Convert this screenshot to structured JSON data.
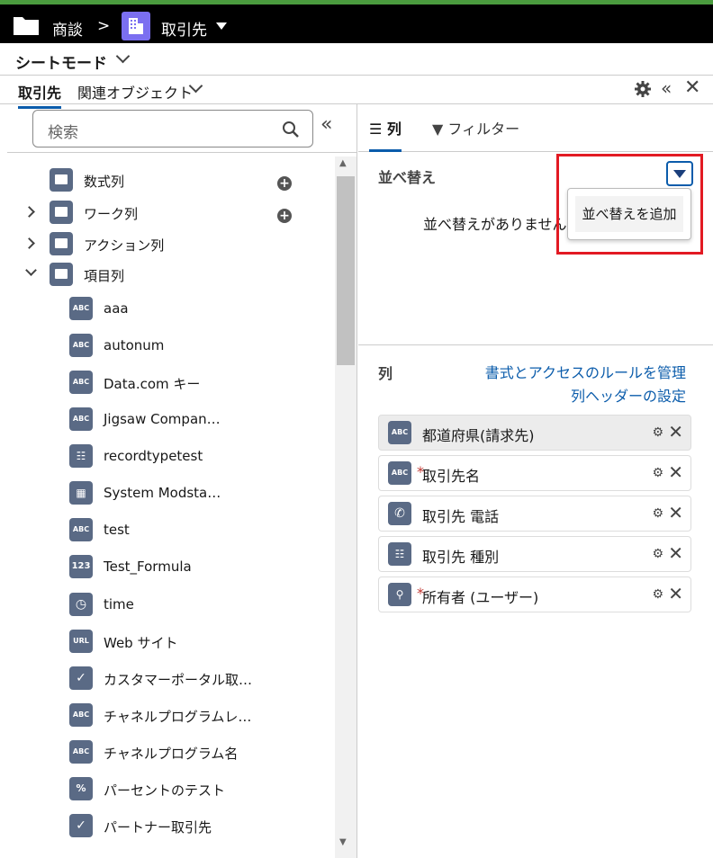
{
  "header": {
    "root_label": "商談",
    "separator": ">",
    "object_label": "取引先"
  },
  "mode": {
    "title": "シートモード"
  },
  "tabs": {
    "primary": "取引先",
    "secondary": "関連オブジェクト"
  },
  "left": {
    "search_placeholder": "検索",
    "nodes": [
      {
        "label": "数式列",
        "type": "folder"
      },
      {
        "label": "ワーク列",
        "type": "folder"
      },
      {
        "label": "アクション列",
        "type": "folder"
      },
      {
        "label": "項目列",
        "type": "folder-open"
      }
    ],
    "fields": [
      {
        "label": "aaa",
        "icon": "ABC"
      },
      {
        "label": "autonum",
        "icon": "ABC"
      },
      {
        "label": "Data.com キー",
        "icon": "ABC"
      },
      {
        "label": "Jigsaw Compan…",
        "icon": "ABC"
      },
      {
        "label": "recordtypetest",
        "icon": "list"
      },
      {
        "label": "System Modsta…",
        "icon": "calendar"
      },
      {
        "label": "test",
        "icon": "ABC"
      },
      {
        "label": "Test_Formula",
        "icon": "123"
      },
      {
        "label": "time",
        "icon": "clock"
      },
      {
        "label": "Web サイト",
        "icon": "URL"
      },
      {
        "label": "カスタマーポータル取…",
        "icon": "check"
      },
      {
        "label": "チャネルプログラムレ…",
        "icon": "ABC"
      },
      {
        "label": "チャネルプログラム名",
        "icon": "ABC"
      },
      {
        "label": "パーセントのテスト",
        "icon": "%"
      },
      {
        "label": "パートナー取引先",
        "icon": "check"
      }
    ]
  },
  "right": {
    "tab_columns": "列",
    "tab_filter": "フィルター",
    "sort_heading": "並べ替え",
    "sort_empty": "並べ替えがありません",
    "menu_item": "並べ替えを追加",
    "columns_heading": "列",
    "link_rules": "書式とアクセスのルールを管理",
    "link_header": "列ヘッダーの設定",
    "columns": [
      {
        "label": "都道府県(請求先)",
        "icon": "ABC",
        "required": false
      },
      {
        "label": "取引先名",
        "icon": "ABC",
        "required": true
      },
      {
        "label": "取引先 電話",
        "icon": "phone",
        "required": false
      },
      {
        "label": "取引先 種別",
        "icon": "list",
        "required": false
      },
      {
        "label": "所有者 (ユーザー)",
        "icon": "user",
        "required": true
      }
    ],
    "required_mark": "*"
  },
  "colors": {
    "accent": "#0b5cab",
    "highlight": "#e21a23",
    "icon_bg": "#5a6a85"
  }
}
